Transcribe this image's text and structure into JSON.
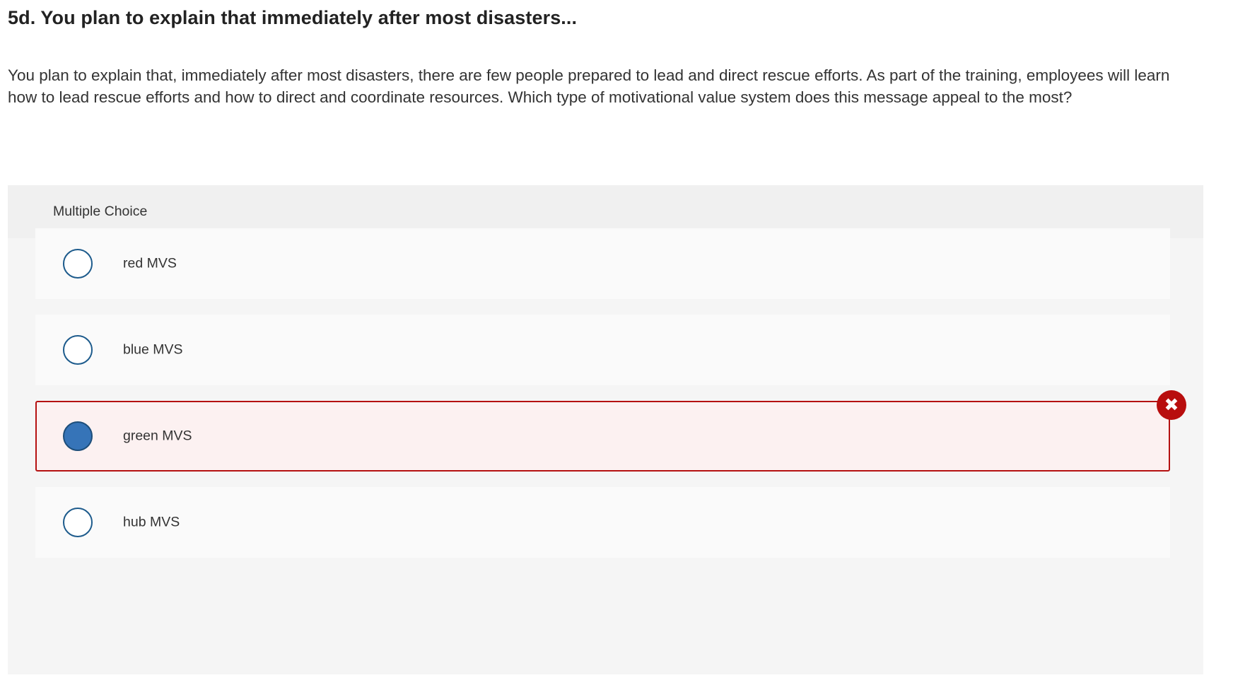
{
  "question": {
    "title": "5d. You plan to explain that immediately after most disasters...",
    "text": "You plan to explain that, immediately after most disasters, there are few people prepared to lead and direct rescue efforts. As part of the training, employees will learn how to lead rescue efforts and how to direct and coordinate resources. Which type of motivational value system does this message appeal to the most?"
  },
  "multiple_choice": {
    "header_label": "Multiple Choice",
    "choices": [
      {
        "label": "red MVS",
        "selected": false,
        "status": ""
      },
      {
        "label": "blue MVS",
        "selected": false,
        "status": ""
      },
      {
        "label": "green MVS",
        "selected": true,
        "status": "incorrect"
      },
      {
        "label": "hub MVS",
        "selected": false,
        "status": ""
      }
    ],
    "incorrect_icon": "close-x-icon",
    "incorrect_icon_glyph": "✖"
  },
  "colors": {
    "incorrect_border": "#b51111",
    "incorrect_bg": "#fcf1f1",
    "incorrect_icon_bg": "#b80e0e",
    "radio_border": "#1d5b8c",
    "radio_selected_fill": "#3674b8",
    "panel_bg": "#f5f5f5",
    "header_bg": "#f0f0f0",
    "choice_bg": "#fafafa"
  }
}
